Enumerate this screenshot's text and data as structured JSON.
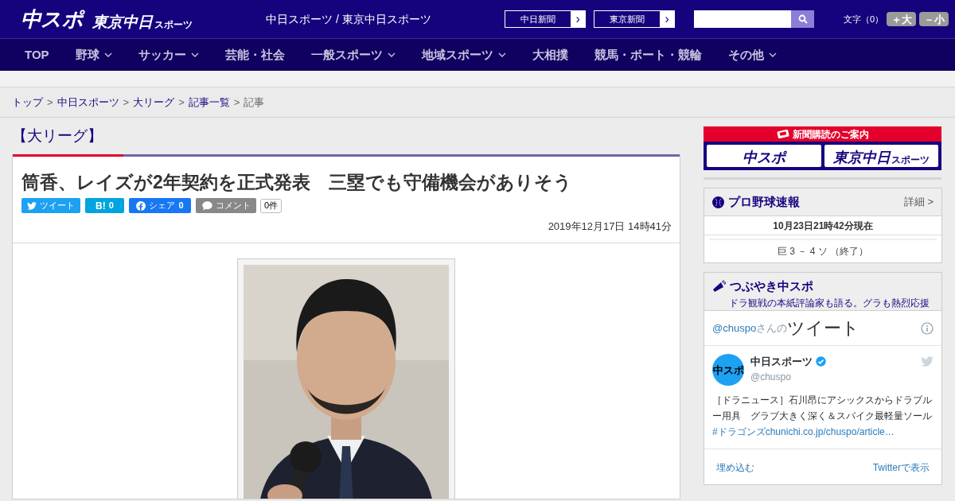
{
  "header": {
    "logo_main": "中スポ",
    "logo_sub": "東京中日",
    "logo_sub_small": "スポーツ",
    "site_title": "中日スポーツ / 東京中日スポーツ",
    "paper_links": [
      {
        "label": "中日新聞",
        "arrow": "›"
      },
      {
        "label": "東京新聞",
        "arrow": "›"
      }
    ],
    "font_size": {
      "label": "文字（0）",
      "buttons": [
        "＋大",
        "－小"
      ]
    }
  },
  "nav": [
    {
      "label": "TOP",
      "has_dropdown": false
    },
    {
      "label": "野球",
      "has_dropdown": true
    },
    {
      "label": "サッカー",
      "has_dropdown": true
    },
    {
      "label": "芸能・社会",
      "has_dropdown": false
    },
    {
      "label": "一般スポーツ",
      "has_dropdown": true
    },
    {
      "label": "地域スポーツ",
      "has_dropdown": true
    },
    {
      "label": "大相撲",
      "has_dropdown": false
    },
    {
      "label": "競馬・ボート・競輪",
      "has_dropdown": false
    },
    {
      "label": "その他",
      "has_dropdown": true
    }
  ],
  "breadcrumb": [
    {
      "label": "トップ",
      "link": true
    },
    {
      "separator": ">",
      "label": "中日スポーツ",
      "link": true
    },
    {
      "separator": ">",
      "label": "大リーグ",
      "link": true
    },
    {
      "separator": ">",
      "label": "記事一覧",
      "link": true
    },
    {
      "separator": ">",
      "label": "記事",
      "link": false
    }
  ],
  "article": {
    "category": "【大リーグ】",
    "title": "筒香、レイズが2年契約を正式発表　三塁でも守備機会がありそう",
    "share_buttons": [
      {
        "kind": "twitter",
        "label": "ツイート"
      },
      {
        "kind": "hatena",
        "label": "B!",
        "count": "0"
      },
      {
        "kind": "facebook",
        "label": "シェア",
        "count": "0"
      },
      {
        "kind": "comment",
        "label": "コメント"
      }
    ],
    "comment_count": "0件",
    "date": "2019年12月17日 14時41分"
  },
  "sidebar": {
    "subscribe": {
      "title": "新聞購読のご案内",
      "logos": [
        {
          "main": "中スポ"
        },
        {
          "main": "東京中日",
          "small": "スポーツ"
        }
      ]
    },
    "baseball": {
      "title": "プロ野球速報",
      "detail_link": "詳細 >",
      "timestamp": "10月23日21時42分現在",
      "score": "巨 3 － 4 ソ （終了）"
    },
    "tweets": {
      "title": "つぶやき中スポ",
      "subtitle": "ドラ観戦の本紙評論家も語る。グラも熱烈応援",
      "handle_link": "@chuspo",
      "handle_suffix": "さんの",
      "heading": "ツイート",
      "tweet": {
        "avatar_text": "中スポ",
        "name": "中日スポーツ",
        "verified": true,
        "handle": "@chuspo",
        "text": "［ドラニュース］石川昂にアシックスからドラブルー用具　グラブ大きく深く＆スパイク最軽量ソール",
        "hashtag": "#ドラゴンズ",
        "link": "chunichi.co.jp/chuspo/article…"
      },
      "footer": [
        "埋め込む",
        "Twitterで表示"
      ]
    }
  }
}
